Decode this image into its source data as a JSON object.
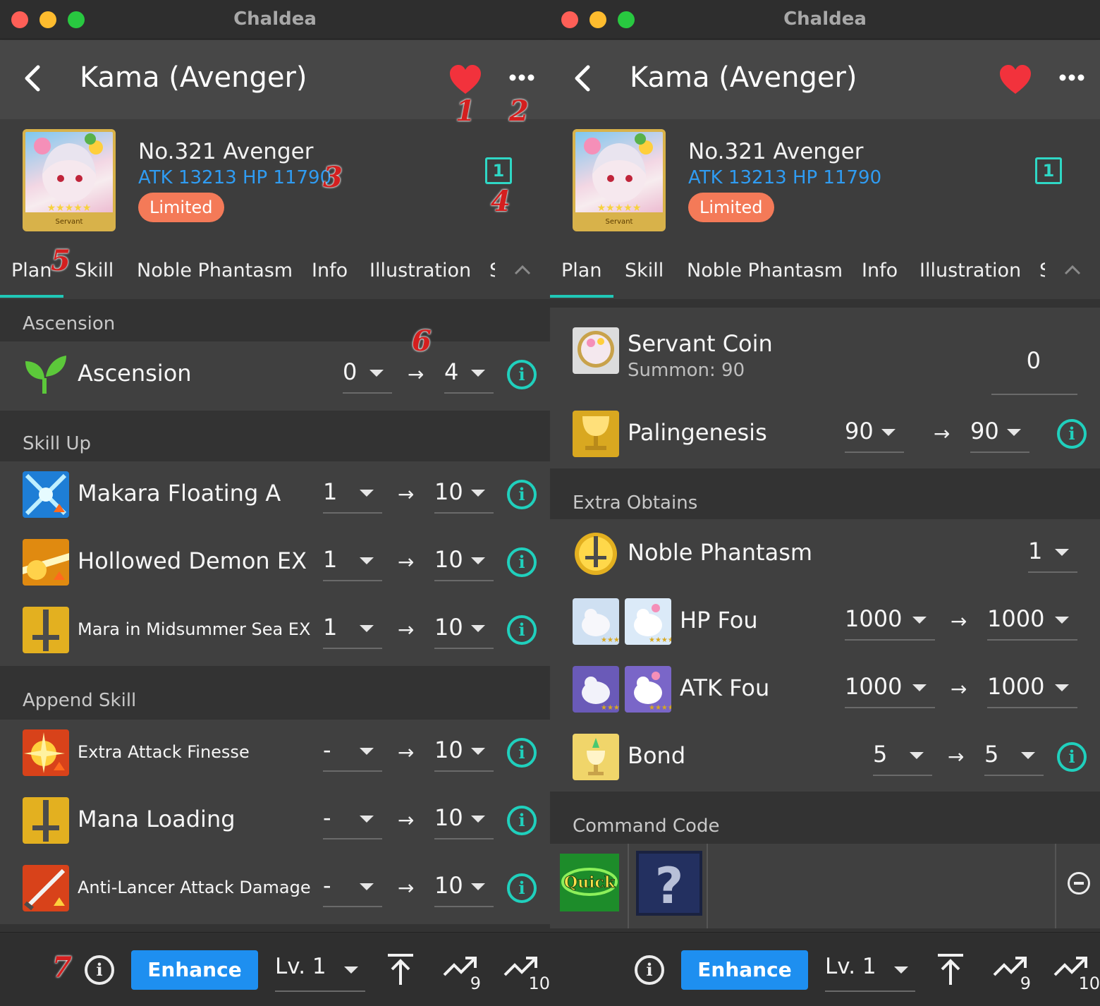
{
  "window": {
    "title": "Chaldea"
  },
  "servant": {
    "name": "Kama (Avenger)",
    "number_class": "No.321  Avenger",
    "stats": "ATK 13213  HP 11790",
    "badge": "Limited",
    "count": "1",
    "avatar_caption": "Servant"
  },
  "tabs": [
    {
      "label": "Plan",
      "active": true
    },
    {
      "label": "Skill"
    },
    {
      "label": "Noble Phantasm"
    },
    {
      "label": "Info"
    },
    {
      "label": "Illustration"
    }
  ],
  "tabs_overflow": "S",
  "left": {
    "sections": [
      {
        "title": "Ascension",
        "rows": [
          {
            "label": "Ascension",
            "icon": "sprout-icon",
            "from": "0",
            "to": "4"
          }
        ]
      },
      {
        "title": "Skill Up",
        "rows": [
          {
            "label": "Makara Floating A",
            "icon": "skill-makara-icon",
            "from": "1",
            "to": "10"
          },
          {
            "label": "Hollowed Demon EX",
            "icon": "skill-hollowed-icon",
            "from": "1",
            "to": "10"
          },
          {
            "label": "Mara in Midsummer Sea EX",
            "icon": "skill-mara-icon",
            "from": "1",
            "to": "10"
          }
        ]
      },
      {
        "title": "Append Skill",
        "rows": [
          {
            "label": "Extra Attack Finesse",
            "icon": "append-extra-attack-icon",
            "from": "-",
            "to": "10"
          },
          {
            "label": "Mana Loading",
            "icon": "append-mana-icon",
            "from": "-",
            "to": "10"
          },
          {
            "label": "Anti-Lancer Attack Damage",
            "icon": "append-anti-lancer-icon",
            "from": "-",
            "to": "10"
          }
        ]
      }
    ]
  },
  "right": {
    "servant_coin": {
      "label": "Servant Coin",
      "sub": "Summon: 90",
      "value": "0"
    },
    "palingenesis": {
      "label": "Palingenesis",
      "from": "90",
      "to": "90"
    },
    "extra_obtains": {
      "title": "Extra Obtains",
      "noble_phantasm": {
        "label": "Noble Phantasm",
        "value": "1"
      },
      "hp_fou": {
        "label": "HP Fou",
        "from": "1000",
        "to": "1000"
      },
      "atk_fou": {
        "label": "ATK Fou",
        "from": "1000",
        "to": "1000"
      },
      "bond": {
        "label": "Bond",
        "from": "5",
        "to": "5"
      }
    },
    "command_code": {
      "title": "Command Code",
      "card": "Quick",
      "empty": "?"
    }
  },
  "footer": {
    "enhance": "Enhance",
    "level": "Lv. 1",
    "to_nine": "9",
    "to_ten": "10"
  },
  "annotations": [
    "1",
    "2",
    "3",
    "4",
    "5",
    "6",
    "7"
  ],
  "colors": {
    "accent_teal": "#20c8b7",
    "stats_blue": "#2f9cf2",
    "badge_orange": "#f47a58",
    "enhance_blue": "#1e8ff0",
    "heart_red": "#f2323c"
  }
}
